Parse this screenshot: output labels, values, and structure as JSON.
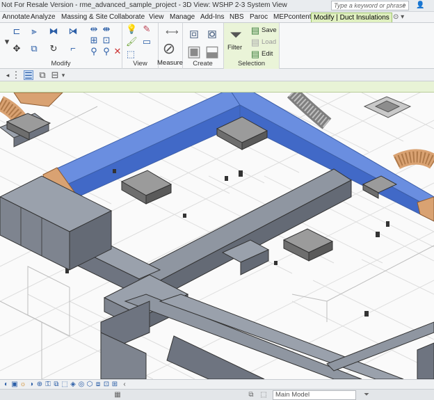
{
  "titlebar": {
    "title": "Not For Resale Version -   rme_advanced_sample_project - 3D View: WSHP 2-3 System View",
    "search_placeholder": "Type a keyword or phrase",
    "search_icon": "search-icon",
    "user_icon": "user-icon"
  },
  "ribbon_tabs": [
    {
      "label": "Annotate"
    },
    {
      "label": "Analyze"
    },
    {
      "label": "Massing & Site"
    },
    {
      "label": "Collaborate"
    },
    {
      "label": "View"
    },
    {
      "label": "Manage"
    },
    {
      "label": "Add-Ins"
    },
    {
      "label": "NBS"
    },
    {
      "label": "Paroc"
    },
    {
      "label": "MEPcontent"
    },
    {
      "label": "Modify | Duct Insulations",
      "active": true
    }
  ],
  "ribbon": {
    "groups": {
      "modify": "Modify",
      "view": "View",
      "measure": "Measure",
      "create": "Create",
      "selection": "Selection"
    },
    "filter_label": "Filter",
    "save_label": "Save",
    "load_label": "Load",
    "edit_label": "Edit"
  },
  "statusbar": {
    "model_label": "Main Model"
  },
  "colors": {
    "accent_tab": "#e0f0c0",
    "duct": "#7f8a9b",
    "insulation": "#6a8ee0",
    "insulation_side": "#4169c7",
    "flex_duct": "#d9a272"
  }
}
